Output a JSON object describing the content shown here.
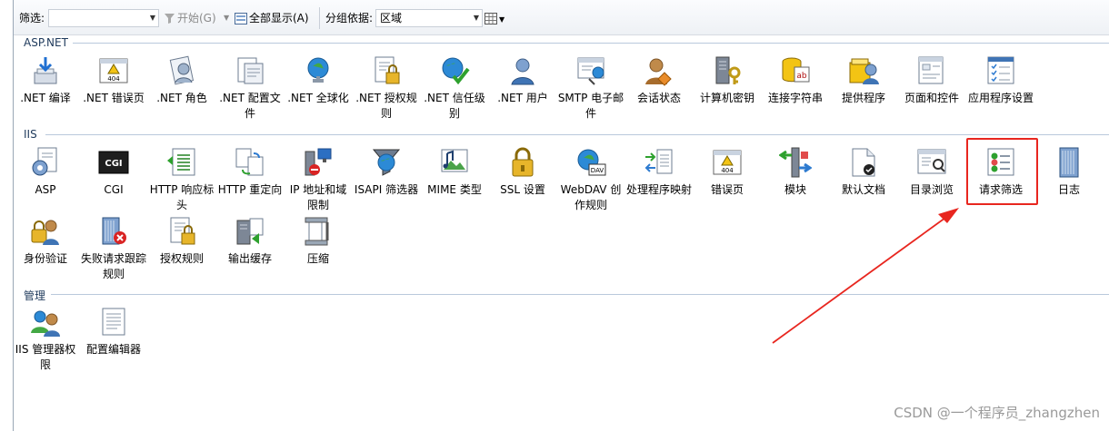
{
  "toolbar": {
    "filter_label": "筛选:",
    "filter_value": "",
    "start_label": "开始(G)",
    "show_all_label": "全部显示(A)",
    "group_label": "分组依据:",
    "group_value": "区域"
  },
  "groups": {
    "aspnet": {
      "title": "ASP.NET",
      "items": [
        {
          "label": ".NET 编译",
          "icon": "download-arrow-icon"
        },
        {
          "label": ".NET 错误页",
          "icon": "warning-404-icon"
        },
        {
          "label": ".NET 角色",
          "icon": "roles-icon"
        },
        {
          "label": ".NET 配置文件",
          "icon": "profile-doc-icon"
        },
        {
          "label": ".NET 全球化",
          "icon": "globe-icon"
        },
        {
          "label": ".NET 授权规则",
          "icon": "lock-doc-icon"
        },
        {
          "label": ".NET 信任级别",
          "icon": "trust-check-icon"
        },
        {
          "label": ".NET 用户",
          "icon": "user-icon"
        },
        {
          "label": "SMTP 电子邮件",
          "icon": "mail-icon"
        },
        {
          "label": "会话状态",
          "icon": "session-user-icon"
        },
        {
          "label": "计算机密钥",
          "icon": "machine-key-icon"
        },
        {
          "label": "连接字符串",
          "icon": "connection-string-icon"
        },
        {
          "label": "提供程序",
          "icon": "provider-icon"
        },
        {
          "label": "页面和控件",
          "icon": "pages-controls-icon"
        },
        {
          "label": "应用程序设置",
          "icon": "app-settings-icon"
        }
      ]
    },
    "iis": {
      "title": "IIS",
      "items": [
        {
          "label": "ASP",
          "icon": "asp-gear-icon"
        },
        {
          "label": "CGI",
          "icon": "cgi-icon"
        },
        {
          "label": "HTTP 响应标头",
          "icon": "http-headers-icon"
        },
        {
          "label": "HTTP 重定向",
          "icon": "redirect-icon"
        },
        {
          "label": "IP 地址和域限制",
          "icon": "ip-restrict-icon"
        },
        {
          "label": "ISAPI 筛选器",
          "icon": "isapi-filter-icon"
        },
        {
          "label": "MIME 类型",
          "icon": "mime-icon"
        },
        {
          "label": "SSL 设置",
          "icon": "ssl-lock-icon"
        },
        {
          "label": "WebDAV 创作规则",
          "icon": "webdav-icon"
        },
        {
          "label": "处理程序映射",
          "icon": "handler-mapping-icon"
        },
        {
          "label": "错误页",
          "icon": "error-page-icon"
        },
        {
          "label": "模块",
          "icon": "modules-icon"
        },
        {
          "label": "默认文档",
          "icon": "default-doc-icon"
        },
        {
          "label": "目录浏览",
          "icon": "directory-browse-icon"
        },
        {
          "label": "请求筛选",
          "icon": "request-filter-icon"
        },
        {
          "label": "日志",
          "icon": "log-icon"
        },
        {
          "label": "身份验证",
          "icon": "auth-icon"
        },
        {
          "label": "失败请求跟踪规则",
          "icon": "failed-request-icon"
        },
        {
          "label": "授权规则",
          "icon": "authz-rules-icon"
        },
        {
          "label": "输出缓存",
          "icon": "output-cache-icon"
        },
        {
          "label": "压缩",
          "icon": "compression-icon"
        }
      ]
    },
    "mgmt": {
      "title": "管理",
      "items": [
        {
          "label": "IIS 管理器权限",
          "icon": "manager-permissions-icon"
        },
        {
          "label": "配置编辑器",
          "icon": "config-editor-icon"
        }
      ]
    }
  },
  "watermark": "CSDN @一个程序员_zhangzhen",
  "colors": {
    "highlight": "#e8261f",
    "arrow": "#e8261f"
  }
}
